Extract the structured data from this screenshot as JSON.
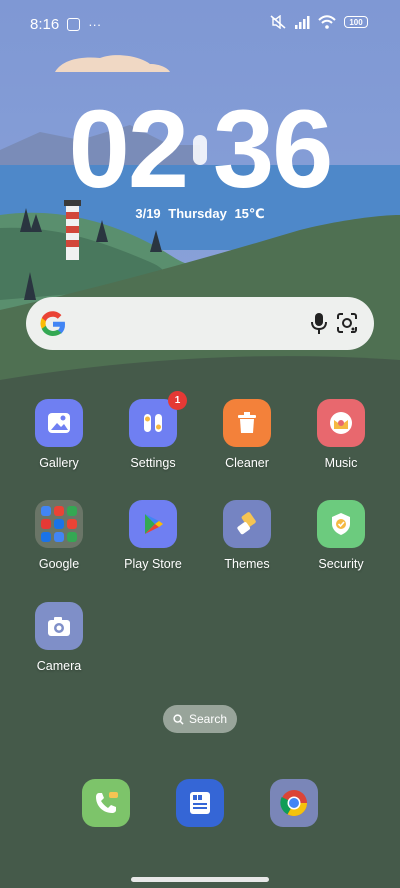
{
  "status_bar": {
    "time": "8:16",
    "more": "···",
    "battery": "100"
  },
  "clock": {
    "hour": "02",
    "minute": "36",
    "date": "3/19",
    "weekday": "Thursday",
    "temperature": "15℃"
  },
  "search_widget": {
    "brand": "Google"
  },
  "apps": [
    {
      "label": "Gallery",
      "icon": "gallery-icon",
      "color": "#6f7ff2"
    },
    {
      "label": "Settings",
      "icon": "settings-icon",
      "color": "#6f7ff2",
      "badge": "1"
    },
    {
      "label": "Cleaner",
      "icon": "trash-icon",
      "color": "#f3813a"
    },
    {
      "label": "Music",
      "icon": "music-icon",
      "color": "#e8686e"
    },
    {
      "label": "Google",
      "icon": "folder-icon",
      "color": "#6a7567"
    },
    {
      "label": "Play Store",
      "icon": "play-store-icon",
      "color": "#6f7ff2"
    },
    {
      "label": "Themes",
      "icon": "brush-icon",
      "color": "#7584c2"
    },
    {
      "label": "Security",
      "icon": "shield-icon",
      "color": "#6ccb7e"
    },
    {
      "label": "Camera",
      "icon": "camera-icon",
      "color": "#7f8fc8"
    }
  ],
  "search_pill": {
    "label": "Search"
  },
  "dock": [
    {
      "icon": "phone-icon",
      "color": "#7dc46a"
    },
    {
      "icon": "messages-icon",
      "color": "#3566d6"
    },
    {
      "icon": "chrome-icon",
      "color": "#7a86b8"
    }
  ]
}
